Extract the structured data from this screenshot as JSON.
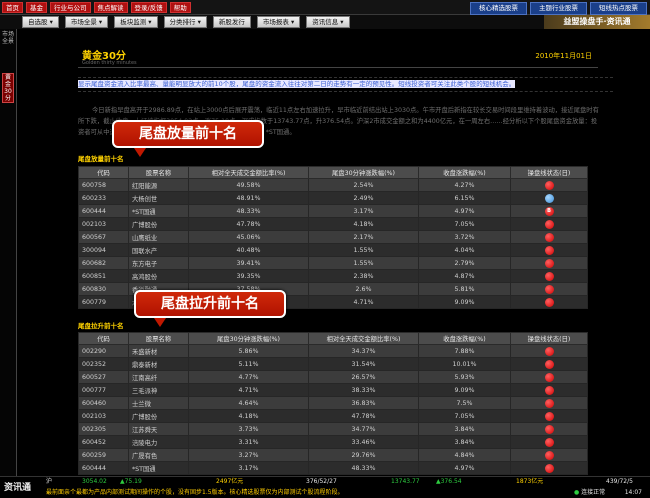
{
  "top_menu": [
    "首页",
    "基金",
    "行业与公司",
    "焦点解读",
    "登录/反馈",
    "帮助"
  ],
  "top_right_buttons": [
    "核心精选股票",
    "主题行业股票",
    "短线热点股票"
  ],
  "nav_buttons": [
    "自选股 ▾",
    "市场全景 ▾",
    "板块监测 ▾",
    "分类排行 ▾",
    "新股发行",
    "市场报表 ▾",
    "资讯信息 ▾"
  ],
  "brand": "益盟操盘手·资讯通",
  "rail_tabs": [
    {
      "label": "市场全景",
      "active": false
    },
    {
      "label": "黄金30分",
      "active": true
    }
  ],
  "page": {
    "title": "黄金30分",
    "subtitle": "Golden thirty minutes",
    "date": "2010年11月01日",
    "intro": "显示尾盘资金流入比率最高、量能明显放大的前10个股，尾盘的资金流入往往对第二日的走势有一定的预见性。短线投资者可关注此类个股的短线机会。",
    "paragraph": "今日新指早盘高开于2986.89点，在站上3000点后展开震荡，临近11点左右加速拉升，早市临近前结出站上3030点。午市开盘后新指在较长交易时间段里维持着波动，接近尾盘时有所下跌，截止收盘，上证综指报3054.02点，涨75.19点。深成指数于13743.77点，升376.54点。沪深2市成交金额之和为4400亿元，在一周左右……经分析以下个股尾盘资金放量：投资者可从中选取标的关注外信以下操作提示买入：它是（600444）*ST国通。"
  },
  "section1": {
    "title": "尾盘放量前十名",
    "headers": [
      "代码",
      "股票名称",
      "相对全天成交金额比率(%)",
      "尾盘30分钟涨跌幅(%)",
      "收盘涨跌幅(%)",
      "操盘线状态(日)"
    ],
    "rows": [
      {
        "code": "600758",
        "name": "红阳能源",
        "c1": "49.58%",
        "c2": "2.54%",
        "c3": "4.27%",
        "dot": "red",
        "dot_label": ""
      },
      {
        "code": "600233",
        "name": "大杨创世",
        "c1": "48.91%",
        "c2": "2.49%",
        "c3": "6.15%",
        "dot": "blue",
        "dot_label": ""
      },
      {
        "code": "600444",
        "name": "*ST国通",
        "c1": "48.33%",
        "c2": "3.17%",
        "c3": "4.97%",
        "dot": "red",
        "dot_label": "B"
      },
      {
        "code": "002103",
        "name": "广博股份",
        "c1": "47.78%",
        "c2": "4.18%",
        "c3": "7.05%",
        "dot": "red",
        "dot_label": ""
      },
      {
        "code": "600567",
        "name": "山鹰纸业",
        "c1": "45.06%",
        "c2": "2.17%",
        "c3": "3.72%",
        "dot": "red",
        "dot_label": ""
      },
      {
        "code": "300094",
        "name": "国联水产",
        "c1": "40.48%",
        "c2": "1.55%",
        "c3": "4.04%",
        "dot": "red",
        "dot_label": ""
      },
      {
        "code": "600682",
        "name": "东方电子",
        "c1": "39.41%",
        "c2": "1.55%",
        "c3": "2.79%",
        "dot": "red",
        "dot_label": ""
      },
      {
        "code": "600851",
        "name": "高鸿股份",
        "c1": "39.35%",
        "c2": "2.38%",
        "c3": "4.87%",
        "dot": "red",
        "dot_label": ""
      },
      {
        "code": "600830",
        "name": "香溢融通",
        "c1": "37.58%",
        "c2": "2.6%",
        "c3": "5.81%",
        "dot": "red",
        "dot_label": ""
      },
      {
        "code": "600779",
        "name": "水井坊",
        "c1": "37.29%",
        "c2": "4.71%",
        "c3": "9.09%",
        "dot": "red",
        "dot_label": ""
      }
    ]
  },
  "section2": {
    "title": "尾盘拉升前十名",
    "headers": [
      "代码",
      "股票名称",
      "尾盘30分钟涨跌幅(%)",
      "相对全天成交金额比率(%)",
      "收盘涨跌幅(%)",
      "操盘线状态(日)"
    ],
    "rows": [
      {
        "code": "002290",
        "name": "禾盛新材",
        "c1": "5.86%",
        "c2": "34.37%",
        "c3": "7.88%",
        "dot": "red",
        "dot_label": ""
      },
      {
        "code": "002352",
        "name": "鼎泰新材",
        "c1": "5.11%",
        "c2": "31.54%",
        "c3": "10.01%",
        "dot": "red",
        "dot_label": ""
      },
      {
        "code": "600527",
        "name": "江南高纤",
        "c1": "4.77%",
        "c2": "26.57%",
        "c3": "5.93%",
        "dot": "red",
        "dot_label": ""
      },
      {
        "code": "000777",
        "name": "三毛派神",
        "c1": "4.71%",
        "c2": "38.33%",
        "c3": "9.09%",
        "dot": "red",
        "dot_label": ""
      },
      {
        "code": "600460",
        "name": "士兰微",
        "c1": "4.64%",
        "c2": "36.83%",
        "c3": "7.5%",
        "dot": "red",
        "dot_label": ""
      },
      {
        "code": "002103",
        "name": "广博股份",
        "c1": "4.18%",
        "c2": "47.78%",
        "c3": "7.05%",
        "dot": "red",
        "dot_label": ""
      },
      {
        "code": "002305",
        "name": "江苏舜天",
        "c1": "3.73%",
        "c2": "34.77%",
        "c3": "3.84%",
        "dot": "red",
        "dot_label": ""
      },
      {
        "code": "600452",
        "name": "涪陵电力",
        "c1": "3.31%",
        "c2": "33.46%",
        "c3": "3.84%",
        "dot": "red",
        "dot_label": ""
      },
      {
        "code": "600259",
        "name": "广晟有色",
        "c1": "3.27%",
        "c2": "29.76%",
        "c3": "4.84%",
        "dot": "red",
        "dot_label": ""
      },
      {
        "code": "600444",
        "name": "*ST国通",
        "c1": "3.17%",
        "c2": "48.33%",
        "c3": "4.97%",
        "dot": "red",
        "dot_label": ""
      }
    ]
  },
  "callouts": {
    "c1": "尾盘放量前十名",
    "c2": "尾盘拉升前十名"
  },
  "status": {
    "label": "资讯通",
    "sh_label": "沪",
    "sh_index": "3054.02",
    "sh_change": "▲75.19",
    "sh_amount": "2497亿元",
    "sh_updown": "376/52/27",
    "sz_index": "13743.77",
    "sz_change": "▲376.54",
    "sz_amount": "1873亿元",
    "sz_updown": "439/72/5",
    "ticker": "最前面亲个最都为产品内部测试期间操作的个股，没有固步1.5版本。核心精选股票仅为内部测试个股流程阶段。",
    "conn": "连接正常",
    "time": "14:07"
  }
}
